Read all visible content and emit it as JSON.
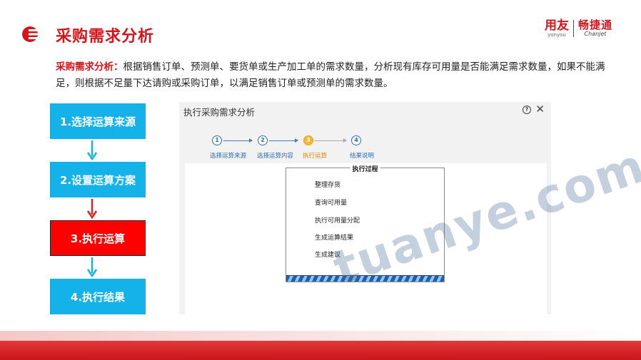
{
  "header": {
    "title": "采购需求分析",
    "brand_primary_cn": "用友",
    "brand_primary_en": "yonyou",
    "brand_secondary_cn": "畅捷通",
    "brand_secondary_en": "Chanjet"
  },
  "description": {
    "lead": "采购需求分析：",
    "body": "根据销售订单、预测单、要货单或生产加工单的需求数量，分析现有库存可用量是否能满足需求数量，如果不能满足，则根据不足量下达请购或采购订单，以满足销售订单或预测单的需求数量。"
  },
  "steps": [
    {
      "label": "1.选择运算来源",
      "active": false
    },
    {
      "label": "2.设置运算方案",
      "active": false
    },
    {
      "label": "3.执行运算",
      "active": true
    },
    {
      "label": "4.执行结果",
      "active": false
    }
  ],
  "window": {
    "title": "执行采购需求分析",
    "help_icon": "?",
    "close_icon": "✕",
    "wizard": [
      {
        "num": "1",
        "label": "选择运算来源",
        "current": false
      },
      {
        "num": "2",
        "label": "选择运算内容",
        "current": false
      },
      {
        "num": "3",
        "label": "执行运算",
        "current": true
      },
      {
        "num": "4",
        "label": "结果说明",
        "current": false
      }
    ],
    "process": {
      "title": "执行过程",
      "items": [
        "整理存货",
        "查询可用量",
        "执行可用量分配",
        "生成运算结果",
        "生成建议"
      ]
    }
  },
  "watermark": "tuanye.com",
  "colors": {
    "accent_red": "#d7141c",
    "step_blue": "#14b2e9",
    "step_active": "#ff0000",
    "arrow_red": "#e02020"
  }
}
